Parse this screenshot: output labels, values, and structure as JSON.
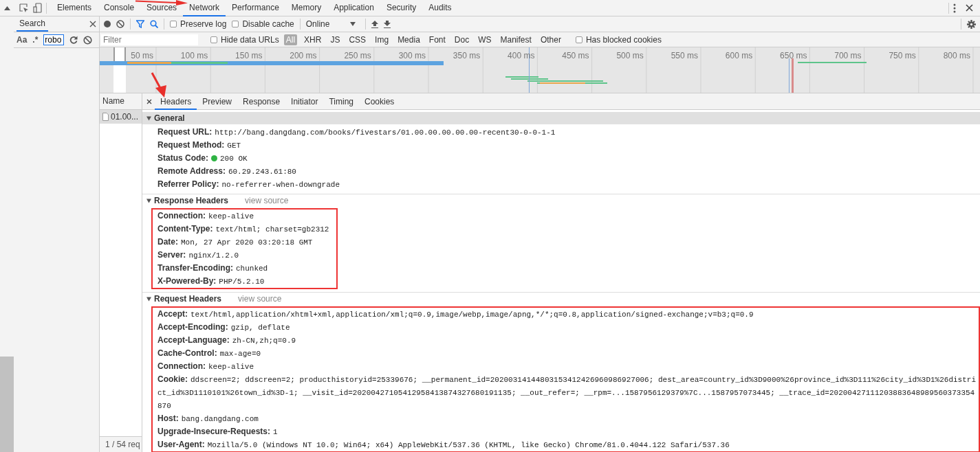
{
  "top_tabs": [
    {
      "label": "Elements",
      "selected": false
    },
    {
      "label": "Console",
      "selected": false
    },
    {
      "label": "Sources",
      "selected": false
    },
    {
      "label": "Network",
      "selected": true
    },
    {
      "label": "Performance",
      "selected": false
    },
    {
      "label": "Memory",
      "selected": false
    },
    {
      "label": "Application",
      "selected": false
    },
    {
      "label": "Security",
      "selected": false
    },
    {
      "label": "Audits",
      "selected": false
    }
  ],
  "search_panel": {
    "tab": "Search",
    "case_label": "Aa",
    "regex_label": ".*",
    "query": "robo"
  },
  "toolbar": {
    "options": [
      {
        "label": "Preserve log",
        "checked": false
      },
      {
        "label": "Disable cache",
        "checked": false
      }
    ],
    "throttling": "Online"
  },
  "filter": {
    "placeholder": "Filter",
    "hide_data_urls": {
      "label": "Hide data URLs",
      "checked": false
    },
    "types": [
      {
        "label": "All",
        "selected": true
      },
      {
        "label": "XHR",
        "selected": false
      },
      {
        "label": "JS",
        "selected": false
      },
      {
        "label": "CSS",
        "selected": false
      },
      {
        "label": "Img",
        "selected": false
      },
      {
        "label": "Media",
        "selected": false
      },
      {
        "label": "Font",
        "selected": false
      },
      {
        "label": "Doc",
        "selected": false
      },
      {
        "label": "WS",
        "selected": false
      },
      {
        "label": "Manifest",
        "selected": false
      },
      {
        "label": "Other",
        "selected": false
      }
    ],
    "blocked_cookies": {
      "label": "Has blocked cookies",
      "checked": false
    }
  },
  "overview_ticks": [
    "50 ms",
    "100 ms",
    "150 ms",
    "200 ms",
    "250 ms",
    "300 ms",
    "350 ms",
    "400 ms",
    "450 ms",
    "500 ms",
    "550 ms",
    "600 ms",
    "650 ms",
    "700 ms",
    "750 ms",
    "800 ms"
  ],
  "requests": {
    "column": "Name",
    "rows": [
      {
        "name": "01.00...",
        "selected": true
      }
    ],
    "status": "1 / 54 req"
  },
  "detail_tabs": [
    {
      "label": "Headers",
      "selected": true
    },
    {
      "label": "Preview",
      "selected": false
    },
    {
      "label": "Response",
      "selected": false
    },
    {
      "label": "Initiator",
      "selected": false
    },
    {
      "label": "Timing",
      "selected": false
    },
    {
      "label": "Cookies",
      "selected": false
    }
  ],
  "sections": [
    {
      "title": "General",
      "expanded": true,
      "items": [
        {
          "name": "Request URL:",
          "value": "http://bang.dangdang.com/books/fivestars/01.00.00.00.00.00-recent30-0-0-1-1"
        },
        {
          "name": "Request Method:",
          "value": "GET"
        },
        {
          "name": "Status Code:",
          "value": "200 OK",
          "kind": "status",
          "color": "#2fb344"
        },
        {
          "name": "Remote Address:",
          "value": "60.29.243.61:80"
        },
        {
          "name": "Referrer Policy:",
          "value": "no-referrer-when-downgrade"
        }
      ]
    },
    {
      "title": "Response Headers",
      "view_source": "view source",
      "expanded": true,
      "highlighted": true,
      "items": [
        {
          "name": "Connection:",
          "value": "keep-alive"
        },
        {
          "name": "Content-Type:",
          "value": "text/html; charset=gb2312"
        },
        {
          "name": "Date:",
          "value": "Mon, 27 Apr 2020 03:20:18 GMT"
        },
        {
          "name": "Server:",
          "value": "nginx/1.2.0"
        },
        {
          "name": "Transfer-Encoding:",
          "value": "chunked"
        },
        {
          "name": "X-Powered-By:",
          "value": "PHP/5.2.10"
        }
      ]
    },
    {
      "title": "Request Headers",
      "view_source": "view source",
      "expanded": true,
      "highlighted": true,
      "items": [
        {
          "name": "Accept:",
          "value": "text/html,application/xhtml+xml,application/xml;q=0.9,image/webp,image/apng,*/*;q=0.8,application/signed-exchange;v=b3;q=0.9"
        },
        {
          "name": "Accept-Encoding:",
          "value": "gzip, deflate"
        },
        {
          "name": "Accept-Language:",
          "value": "zh-CN,zh;q=0.9"
        },
        {
          "name": "Cache-Control:",
          "value": "max-age=0"
        },
        {
          "name": "Connection:",
          "value": "keep-alive"
        },
        {
          "name": "Cookie:",
          "value": "ddscreen=2; ddscreen=2; producthistoryid=25339676; __permanent_id=20200314144803153412426960986927006; dest_area=country_id%3D9000%26province_id%3D111%26city_id%3D1%26district_id%3D1110101%26town_id%3D-1; __visit_id=20200427105412958413874327680191135; __out_refer=; __rpm=...1587956129379%7C...1587957073445; __trace_id=20200427111203883648989560373354870"
        },
        {
          "name": "Host:",
          "value": "bang.dangdang.com"
        },
        {
          "name": "Upgrade-Insecure-Requests:",
          "value": "1"
        },
        {
          "name": "User-Agent:",
          "value": "Mozilla/5.0 (Windows NT 10.0; Win64; x64) AppleWebKit/537.36 (KHTML, like Gecko) Chrome/81.0.4044.122 Safari/537.36"
        }
      ]
    }
  ]
}
